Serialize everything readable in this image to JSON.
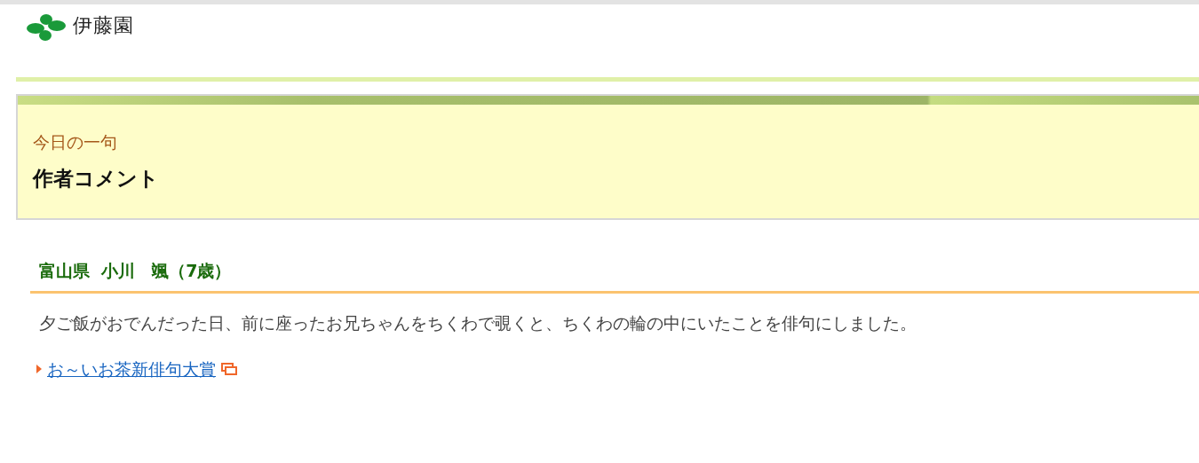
{
  "logo": {
    "text": "伊藤園"
  },
  "panel": {
    "label": "今日の一句",
    "title": "作者コメント"
  },
  "entry": {
    "heading": "富山県  小川　颯（7歳）",
    "comment": "夕ご飯がおでんだった日、前に座ったお兄ちゃんをちくわで覗くと、ちくわの輪の中にいたことを俳句にしました。"
  },
  "link": {
    "label": "お～いお茶新俳句大賞",
    "external": true
  }
}
